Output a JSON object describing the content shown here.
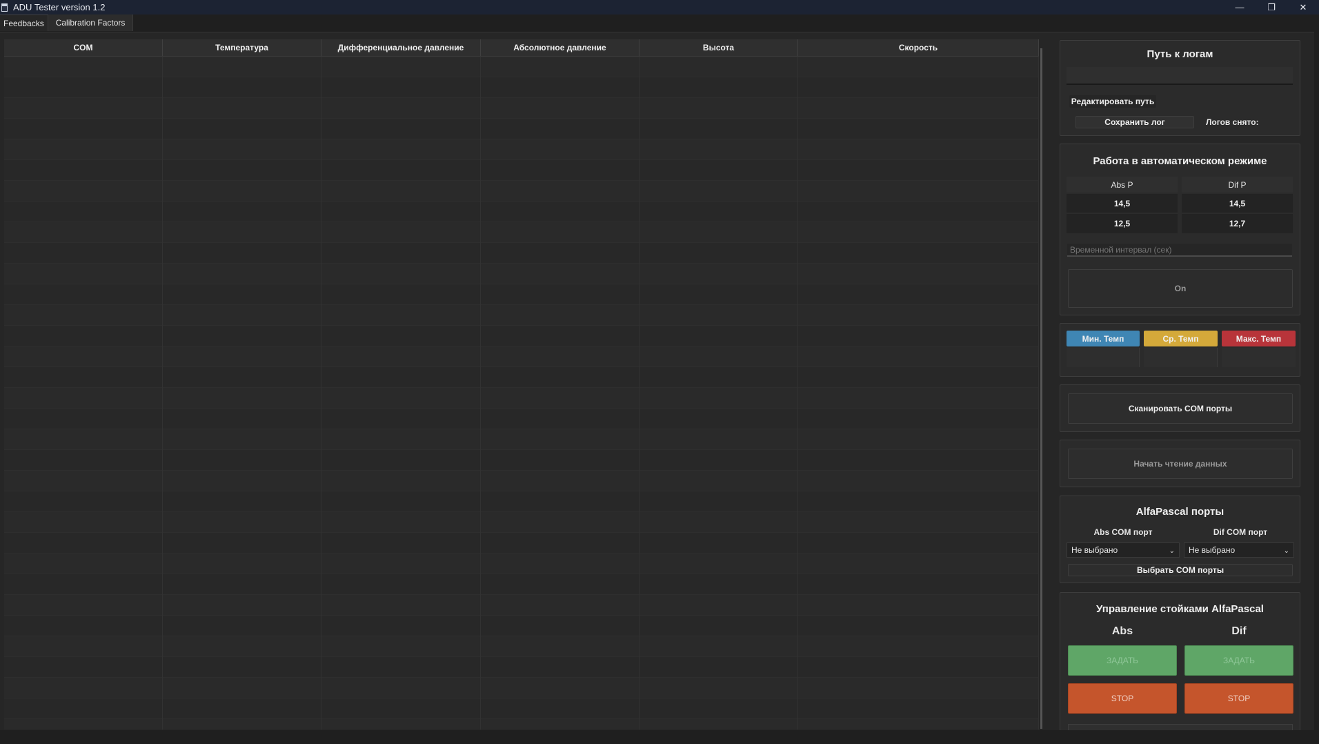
{
  "window": {
    "title": "ADU Tester version 1.2",
    "controls": {
      "minimize": "—",
      "restore": "❐",
      "close": "✕"
    }
  },
  "tabs": [
    "Feedbacks",
    "Calibration Factors"
  ],
  "table": {
    "columns": [
      "COM",
      "Температура",
      "Дифференциальное давление",
      "Абсолютное давление",
      "Высота",
      "Скорость"
    ]
  },
  "logs": {
    "title": "Путь к логам",
    "path_value": "",
    "edit_path": "Редактировать путь",
    "save_log": "Сохранить лог",
    "logs_taken": "Логов снято:"
  },
  "auto": {
    "title": "Работа в автоматическом режиме",
    "abs_header": "Abs P",
    "dif_header": "Dif P",
    "abs_values": [
      "14,5",
      "12,5"
    ],
    "dif_values": [
      "14,5",
      "12,7"
    ],
    "interval_placeholder": "Временной интервал (сек)",
    "on_button": "On"
  },
  "temps": {
    "min": "Мин. Темп",
    "avg": "Ср. Темп",
    "max": "Макс. Темп",
    "colors": {
      "min": "#3f86b4",
      "avg": "#d4a93a",
      "max": "#b8343a"
    }
  },
  "scan": {
    "button": "Сканировать COM порты"
  },
  "read": {
    "button": "Начать чтение данных"
  },
  "alfa_ports": {
    "title": "AlfaPascal порты",
    "abs_label": "Abs COM порт",
    "dif_label": "Dif COM порт",
    "abs_selected": "Не выбрано",
    "dif_selected": "Не выбрано",
    "choose_button": "Выбрать COM порты"
  },
  "stands": {
    "title": "Управление стойками AlfaPascal",
    "abs_label": "Abs",
    "dif_label": "Dif",
    "set_label": "ЗАДАТЬ",
    "stop_label": "STOP",
    "colors": {
      "set": "#5fa667",
      "stop": "#c5552c"
    }
  }
}
